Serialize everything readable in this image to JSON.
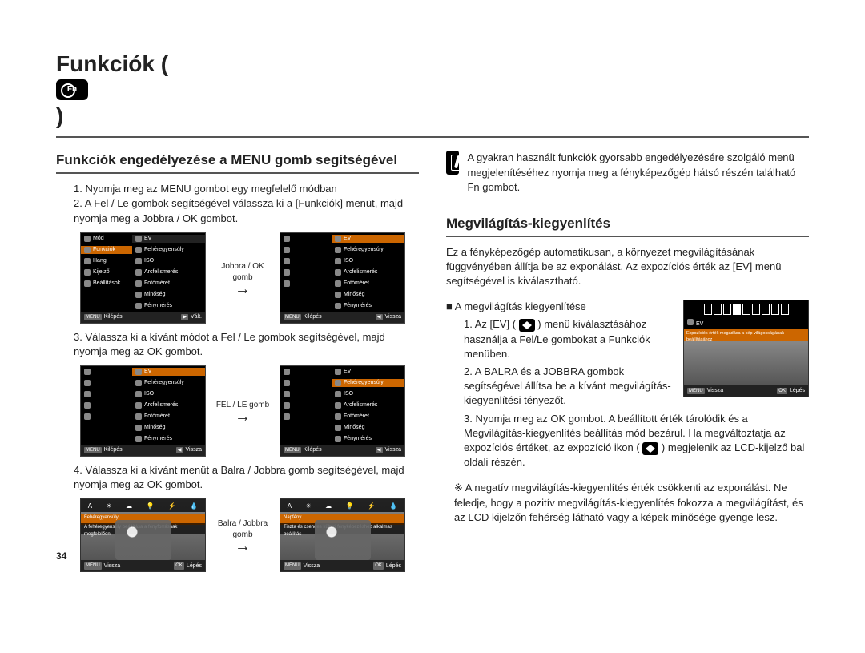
{
  "page_number": "34",
  "headline": "Funkciók (",
  "headline_close": ")",
  "left": {
    "subtitle": "Funkciók engedélyezése a MENU gomb segítségével",
    "step1": "1. Nyomja meg az MENU gombot egy megfelelő módban",
    "step2": "2. A Fel / Le gombok segítségével válassza ki a [Funkciók] menüt, majd nyomja meg a Jobbra / OK gombot.",
    "step3": "3. Válassza ki a kívánt módot a Fel / Le gombok segítségével, majd nyomja meg az OK gombot.",
    "step4": "4. Válassza ki a kívánt menüt a Balra / Jobbra gomb segítségével, majd nyomja meg az OK gombot.",
    "arrow1": "Jobbra / OK gomb",
    "arrow2": "FEL / LE gomb",
    "arrow3": "Balra / Jobbra gomb",
    "menuA": {
      "left_items": [
        "Mód",
        "Funkciók",
        "Hang",
        "Kijelző",
        "Beállítások"
      ],
      "right_items": [
        "EV",
        "Fehéregyensúly",
        "ISO",
        "Arcfelismerés",
        "Fotóméret",
        "Minőség",
        "Fénymérés"
      ],
      "footer_left_key": "MENU",
      "footer_left": "Kilépés",
      "footer_right_key": "▶",
      "footer_right": "Vált."
    },
    "menuB": {
      "right_items": [
        "EV",
        "Fehéregyensúly",
        "ISO",
        "Arcfelismerés",
        "Fotóméret",
        "Minőség",
        "Fénymérés"
      ],
      "footer_left_key": "MENU",
      "footer_left": "Kilépés",
      "footer_right_key": "◀",
      "footer_right": "Vissza"
    },
    "wb": {
      "label_left": "Fehéregyensúly",
      "desc_left": "A fehéregyensúly beállítása a fényforrásnak megfelelően",
      "label_right": "Napfény",
      "desc_right": "Tiszta és csendes kültéri fényképezéshez alkalmas beállítás",
      "footer_left_key": "MENU",
      "footer_left": "Vissza",
      "footer_right_key": "OK",
      "footer_right": "Lépés"
    }
  },
  "right": {
    "tip": "A gyakran használt funkciók gyorsabb engedélyezésére szolgáló menü megjelenítéséhez nyomja meg a fényképezőgép hátsó részén található Fn gombot.",
    "subtitle": "Megvilágítás-kiegyenlítés",
    "para1": "Ez a fényképezőgép automatikusan, a környezet megvilágításának függvényében állítja be az exponálást. Az expozíciós érték az [EV] menü segítségével is kiválasztható.",
    "bullet": "A megvilágítás kiegyenlítése",
    "step1a": "1. Az [EV] (",
    "step1b": ") menü kiválasztásához használja a Fel/Le gombokat a Funkciók menüben.",
    "step2": "2. A BALRA és a JOBBRA gombok segítségével állítsa be a kívánt megvilágítás-kiegyenlítési tényezőt.",
    "step3a": "3. Nyomja meg az OK gombot. A beállított érték tárolódik és a Megvilágítás-kiegyenlítés beállítás mód bezárul. Ha megváltoztatja az expozíciós értéket, az expozíció ikon (",
    "step3b": ") megjelenik az LCD-kijelző bal oldali részén.",
    "note": "※ A negatív megvilágítás-kiegyenlítés érték csökkenti az exponálást. Ne feledje, hogy a pozitív megvilágítás-kiegyenlítés fokozza a megvilágítást, és az LCD kijelzőn fehérség látható vagy a képek minõsége gyenge lesz.",
    "ev": {
      "label": "EV",
      "desc": "Expozíciós érték megadása a kép világosságának beállításához",
      "footer_left_key": "MENU",
      "footer_left": "Vissza",
      "footer_right_key": "OK",
      "footer_right": "Lépés"
    }
  }
}
